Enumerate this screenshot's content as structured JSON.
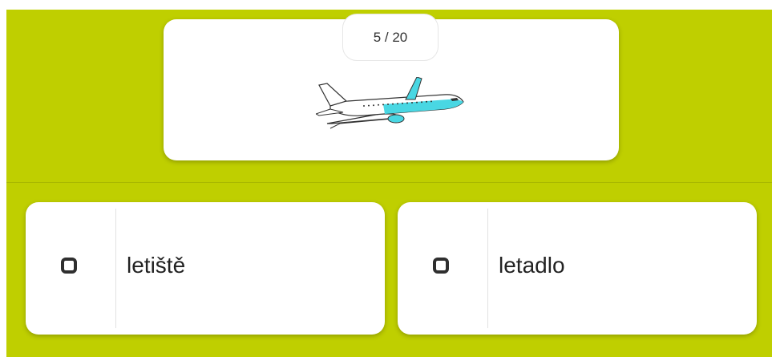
{
  "progress": {
    "counter_text": "5 / 20"
  },
  "prompt": {
    "image_icon": "airplane-icon"
  },
  "answers": [
    {
      "label": "letiště",
      "checkbox_icon": "checkbox-icon"
    },
    {
      "label": "letadlo",
      "checkbox_icon": "checkbox-icon"
    }
  ],
  "colors": {
    "background": "#bfcf00",
    "card": "#ffffff",
    "plane_accent": "#49d7e3"
  }
}
